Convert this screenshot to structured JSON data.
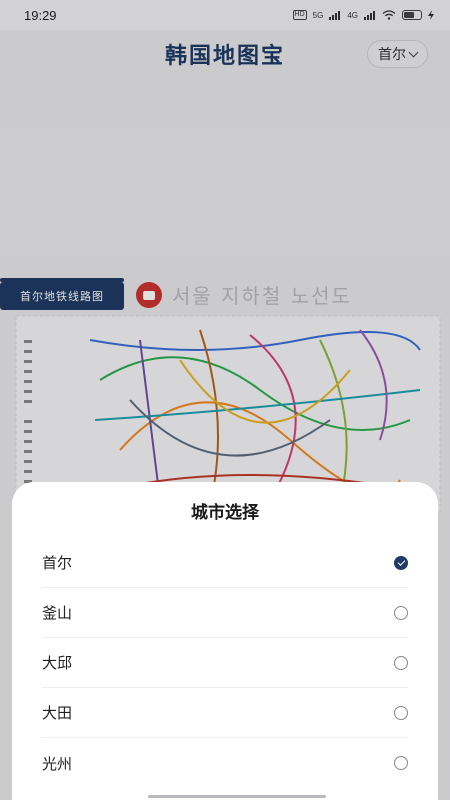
{
  "status_bar": {
    "time": "19:29",
    "network_1": "HD",
    "network_2": "5G",
    "network_3": "4G"
  },
  "header": {
    "title": "韩国地图宝",
    "city_selector": "首尔"
  },
  "map": {
    "tag": "首尔地铁线路图",
    "korean_title": "서울 지하철 노선도"
  },
  "city_sheet": {
    "title": "城市选择",
    "selected": "首尔",
    "cities": [
      "首尔",
      "釜山",
      "大邱",
      "大田",
      "光州"
    ]
  },
  "colors": {
    "brand_navy": "#1f3b66",
    "metro_red": "#cc3333"
  }
}
